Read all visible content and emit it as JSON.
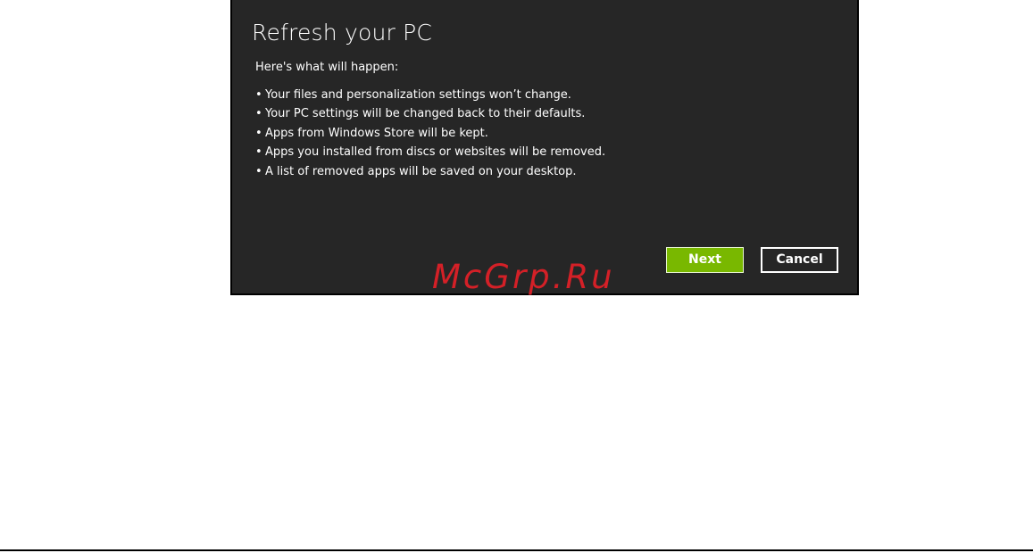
{
  "dialog": {
    "title": "Refresh your PC",
    "intro": "Here's what will happen:",
    "bullet_marker": "•",
    "bullets": [
      "Your files and personalization settings won’t change.",
      "Your PC settings will be changed back to their defaults.",
      "Apps from Windows Store will be kept.",
      "Apps you installed from discs or websites will be removed.",
      "A list of removed apps will be saved on your desktop."
    ],
    "buttons": {
      "next_label": "Next",
      "cancel_label": "Cancel"
    }
  },
  "watermark": "McGrp.Ru",
  "colors": {
    "dialog_background": "#262626",
    "accent_green": "#79b800",
    "text": "#ffffff",
    "watermark": "#e32028"
  }
}
